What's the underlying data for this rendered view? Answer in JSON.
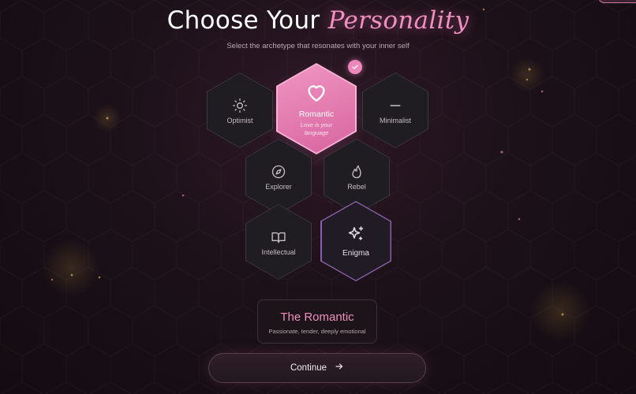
{
  "header": {
    "title_plain": "Choose Your",
    "title_accent": "Personality",
    "subtitle": "Select the archetype that resonates with your inner self"
  },
  "archetypes": [
    {
      "label": "Optimist",
      "icon": "sun-icon",
      "selected": false
    },
    {
      "label": "Romantic",
      "icon": "heart-icon",
      "description": "Love is your language",
      "selected": true
    },
    {
      "label": "Minimalist",
      "icon": "minus-icon",
      "selected": false
    },
    {
      "label": "Explorer",
      "icon": "compass-icon",
      "selected": false
    },
    {
      "label": "Rebel",
      "icon": "flame-icon",
      "selected": false
    },
    {
      "label": "Intellectual",
      "icon": "book-icon",
      "selected": false
    },
    {
      "label": "Enigma",
      "icon": "sparkles-icon",
      "selected": false
    }
  ],
  "selection": {
    "name": "The Romantic",
    "traits": "Passionate, tender, deeply emotional"
  },
  "actions": {
    "continue_label": "Continue"
  },
  "colors": {
    "accent_pink": "#ef8fbf",
    "enigma_border": "#8b60a8",
    "background": "#1c1119"
  }
}
